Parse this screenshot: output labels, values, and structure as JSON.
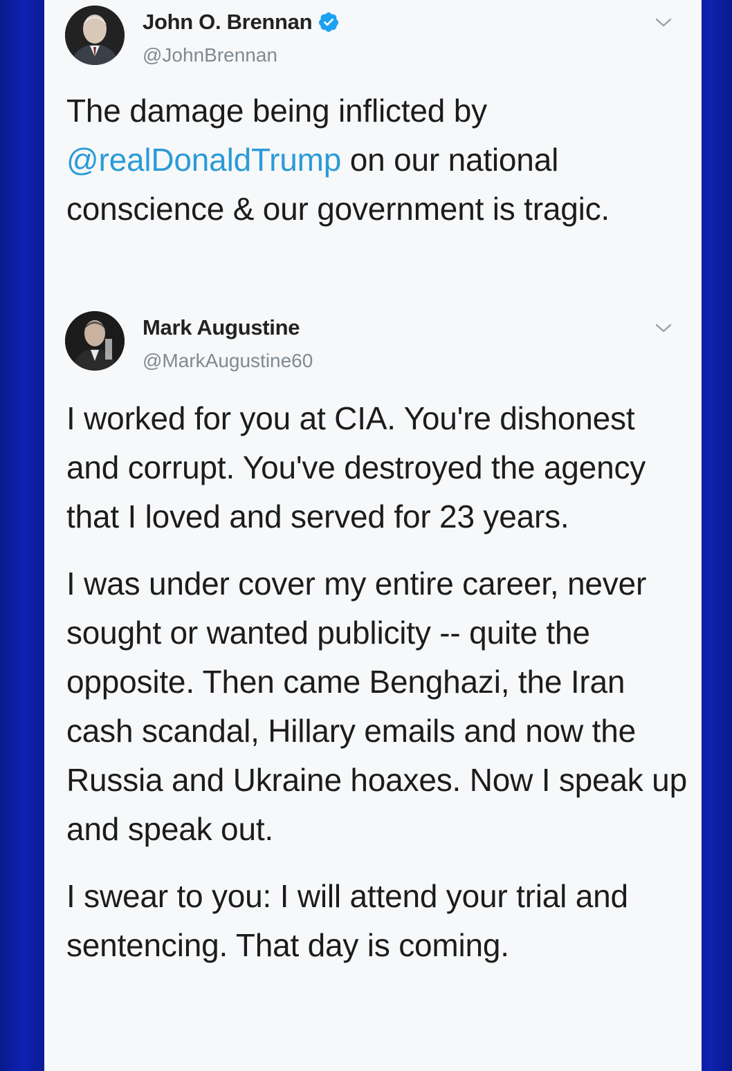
{
  "colors": {
    "background": "#0b1c96",
    "card": "#f7f8f9",
    "mention": "#2a9bd8",
    "verified": "#1da1f2"
  },
  "tweets": [
    {
      "author": {
        "name": "John O. Brennan",
        "handle": "@JohnBrennan",
        "verified": true,
        "avatar_icon": "avatar-photo-icon"
      },
      "text": {
        "before": "The damage being inflicted by ",
        "mention": "@realDonaldTrump",
        "after": " on our national conscience & our government is tragic."
      },
      "menu_icon": "chevron-down-icon"
    },
    {
      "author": {
        "name": "Mark Augustine",
        "handle": "@MarkAugustine60",
        "verified": false,
        "avatar_icon": "avatar-photo-icon"
      },
      "paragraphs": [
        "I worked for you at CIA.  You're dishonest and corrupt.  You've destroyed the agency that I loved and served for 23 years.",
        "I was under cover my entire career, never sought or wanted publicity -- quite the opposite.  Then came Benghazi, the Iran cash scandal, Hillary emails and now the Russia and Ukraine hoaxes.  Now I speak up and speak out.",
        "I swear to you: I will attend your trial and sentencing.  That day is coming."
      ],
      "menu_icon": "chevron-down-icon"
    }
  ]
}
